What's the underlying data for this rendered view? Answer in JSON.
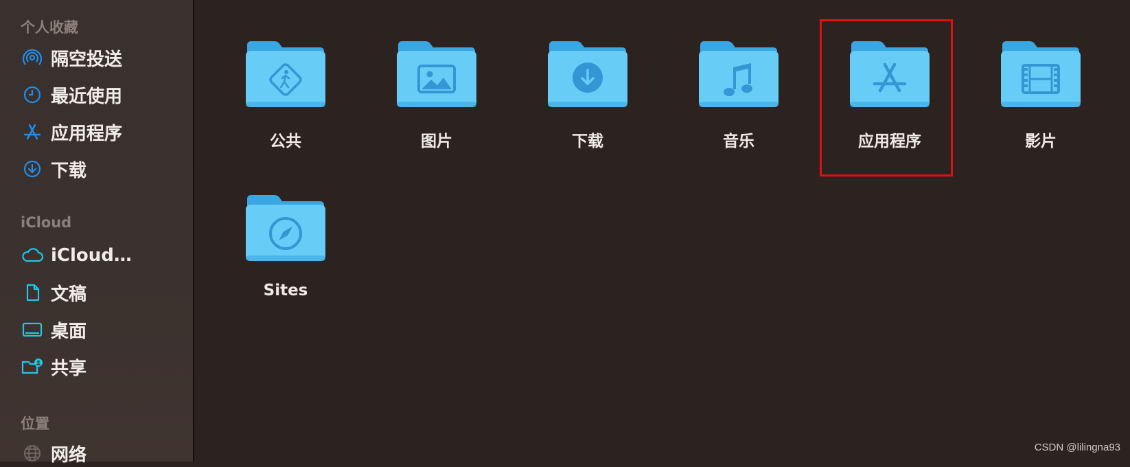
{
  "sidebar": {
    "favorites_title": "个人收藏",
    "favorites": [
      {
        "label": "隔空投送",
        "icon": "airdrop-icon"
      },
      {
        "label": "最近使用",
        "icon": "clock-icon"
      },
      {
        "label": "应用程序",
        "icon": "appstore-icon"
      },
      {
        "label": "下载",
        "icon": "download-icon"
      }
    ],
    "icloud_title": "iCloud",
    "icloud": [
      {
        "label": "iCloud…",
        "icon": "cloud-icon"
      },
      {
        "label": "文稿",
        "icon": "document-icon"
      },
      {
        "label": "桌面",
        "icon": "desktop-icon"
      },
      {
        "label": "共享",
        "icon": "shared-folder-icon"
      }
    ],
    "locations_title": "位置",
    "locations": [
      {
        "label": "网络",
        "icon": "network-icon"
      }
    ]
  },
  "folders": [
    {
      "name": "公共",
      "icon": "public-icon"
    },
    {
      "name": "图片",
      "icon": "photo-icon"
    },
    {
      "name": "下载",
      "icon": "download-icon"
    },
    {
      "name": "音乐",
      "icon": "music-note-icon"
    },
    {
      "name": "应用程序",
      "icon": "appstore-icon"
    },
    {
      "name": "影片",
      "icon": "film-icon"
    },
    {
      "name": "Sites",
      "icon": "compass-icon"
    }
  ],
  "colors": {
    "accent": "#1e8ff0",
    "folder_light": "#68cdf6",
    "folder_dark": "#3aa7e3",
    "highlight": "#e01010"
  },
  "watermark": "CSDN @lilingna93"
}
